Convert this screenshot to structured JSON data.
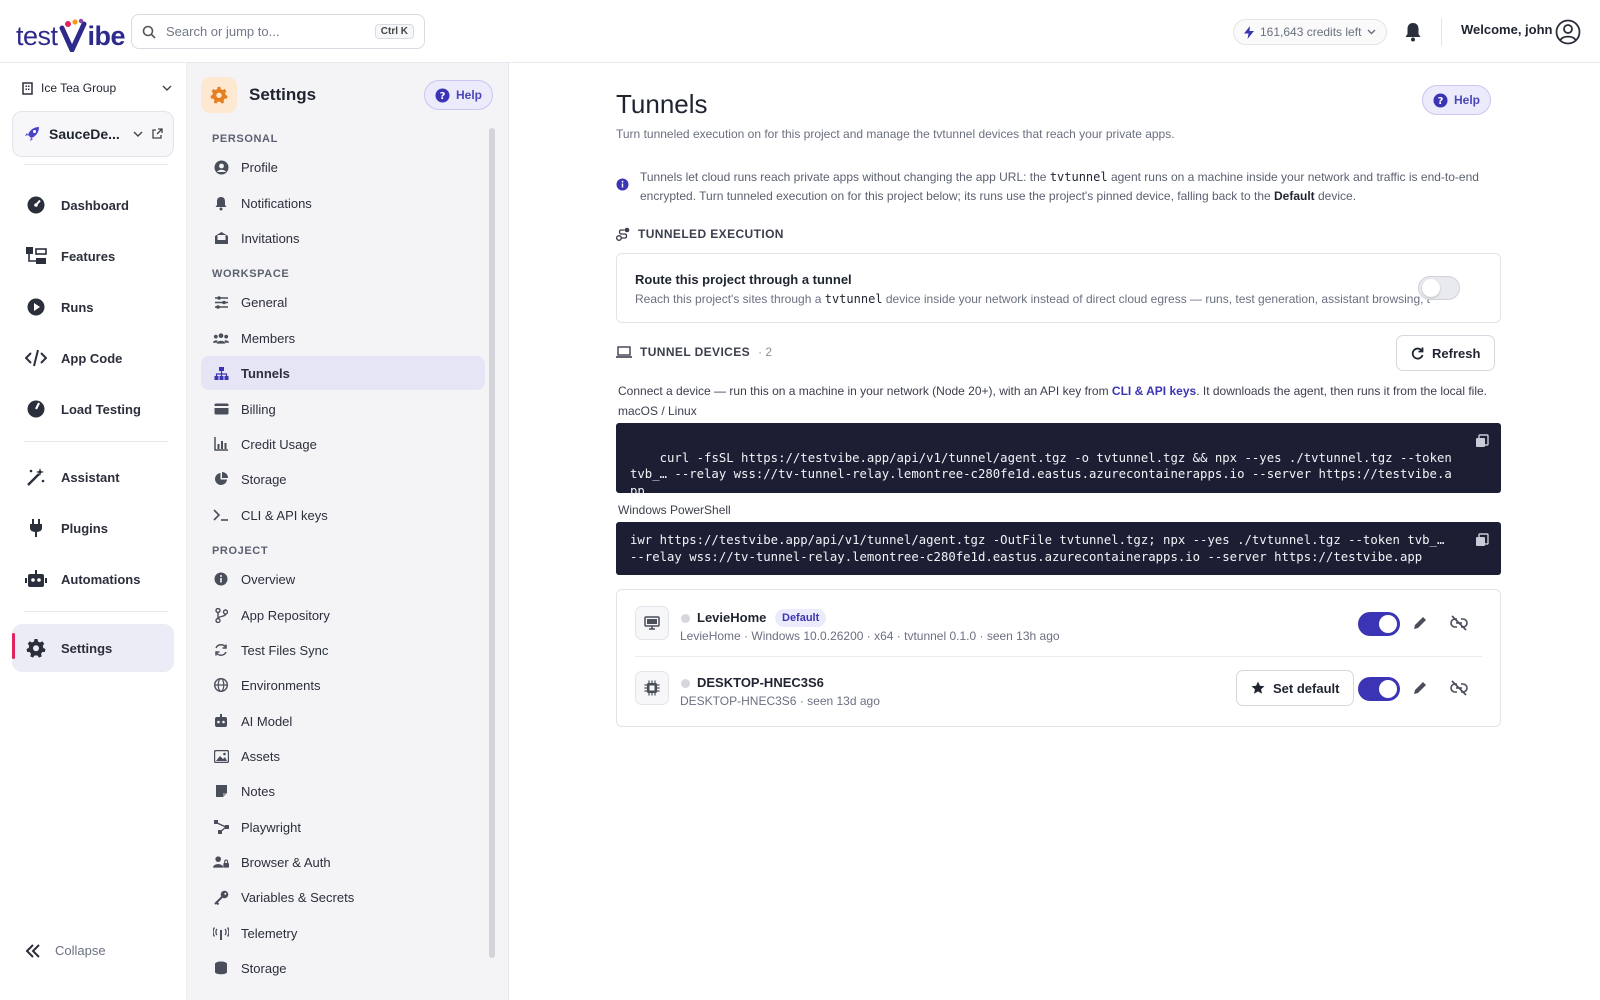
{
  "header": {
    "logo_left": "test",
    "logo_right": "ibe",
    "search_placeholder": "Search or jump to...",
    "search_shortcut": "Ctrl K",
    "credits": "161,643 credits left",
    "welcome": "Welcome, john"
  },
  "leftnav": {
    "org": "Ice Tea Group",
    "project": "SauceDe...",
    "items": [
      {
        "label": "Dashboard",
        "icon": "gauge-icon"
      },
      {
        "label": "Features",
        "icon": "features-icon"
      },
      {
        "label": "Runs",
        "icon": "play-icon"
      },
      {
        "label": "App Code",
        "icon": "code-icon"
      },
      {
        "label": "Load Testing",
        "icon": "speedometer-icon"
      },
      {
        "label": "Assistant",
        "icon": "magic-wand-icon"
      },
      {
        "label": "Plugins",
        "icon": "plug-icon"
      },
      {
        "label": "Automations",
        "icon": "robot-icon"
      },
      {
        "label": "Settings",
        "icon": "gear-icon"
      }
    ],
    "collapse": "Collapse"
  },
  "settings_nav": {
    "title": "Settings",
    "help": "Help",
    "sections": {
      "personal": "PERSONAL",
      "workspace": "WORKSPACE",
      "project": "PROJECT"
    },
    "personal": [
      "Profile",
      "Notifications",
      "Invitations"
    ],
    "workspace": [
      "General",
      "Members",
      "Tunnels",
      "Billing",
      "Credit Usage",
      "Storage",
      "CLI & API keys"
    ],
    "project": [
      "Overview",
      "App Repository",
      "Test Files Sync",
      "Environments",
      "AI Model",
      "Assets",
      "Notes",
      "Playwright",
      "Browser & Auth",
      "Variables & Secrets",
      "Telemetry",
      "Storage"
    ]
  },
  "main": {
    "title": "Tunnels",
    "help": "Help",
    "subtitle": "Turn tunneled execution on for this project and manage the tvtunnel devices that reach your private apps.",
    "info": {
      "part1": "Tunnels let cloud runs reach private apps without changing the app URL: the ",
      "code": "tvtunnel",
      "part2": " agent runs on a machine inside your network and traffic is end-to-end encrypted. Turn tunneled execution on for this project below; its runs use the project's pinned device, falling back to the ",
      "bold": "Default",
      "part3": " device."
    },
    "tunneled_execution": {
      "heading": "TUNNELED EXECUTION",
      "title": "Route this project through a tunnel",
      "desc_part1": "Reach this project's sites through a ",
      "desc_code": "tvtunnel",
      "desc_part2": " device inside your network instead of direct cloud egress — runs, test generation, assistant browsing, an",
      "enabled": false
    },
    "devices_section": {
      "heading": "TUNNEL DEVICES",
      "count": "· 2",
      "refresh": "Refresh",
      "connect_part1": "Connect a device — run this on a machine in your network (Node 20+), with an API key from ",
      "connect_link": "CLI & API keys",
      "connect_part2": ". It downloads the agent, then runs it from the local file.",
      "mac_label": "macOS / Linux",
      "mac_cmd": "curl -fsSL https://testvibe.app/api/v1/tunnel/agent.tgz -o tvtunnel.tgz && npx --yes ./tvtunnel.tgz --token tvb_… --relay wss://tv-tunnel-relay.lemontree-c280fe1d.eastus.azurecontainerapps.io --server https://testvibe.app",
      "win_label": "Windows PowerShell",
      "win_cmd_line1": "iwr https://testvibe.app/api/v1/tunnel/agent.tgz -OutFile tvtunnel.tgz; npx --yes ./tvtunnel.tgz --token tvb_…",
      "win_cmd_line2": "--relay wss://tv-tunnel-relay.lemontree-c280fe1d.eastus.azurecontainerapps.io --server https://testvibe.app"
    },
    "devices": [
      {
        "name": "LevieHome",
        "badge": "Default",
        "meta": "LevieHome · Windows 10.0.26200 · x64 · tvtunnel 0.1.0 · seen 13h ago",
        "enabled": true,
        "icon": "monitor-icon"
      },
      {
        "name": "DESKTOP-HNEC3S6",
        "meta": "DESKTOP-HNEC3S6 · seen 13d ago",
        "set_default": "Set default",
        "enabled": true,
        "icon": "chip-icon"
      }
    ]
  },
  "colors": {
    "accent": "#3b35b5",
    "code_bg": "#1c1f33",
    "active_marker": "#e0245e",
    "settings_icon_bg": "#fde8d2"
  }
}
